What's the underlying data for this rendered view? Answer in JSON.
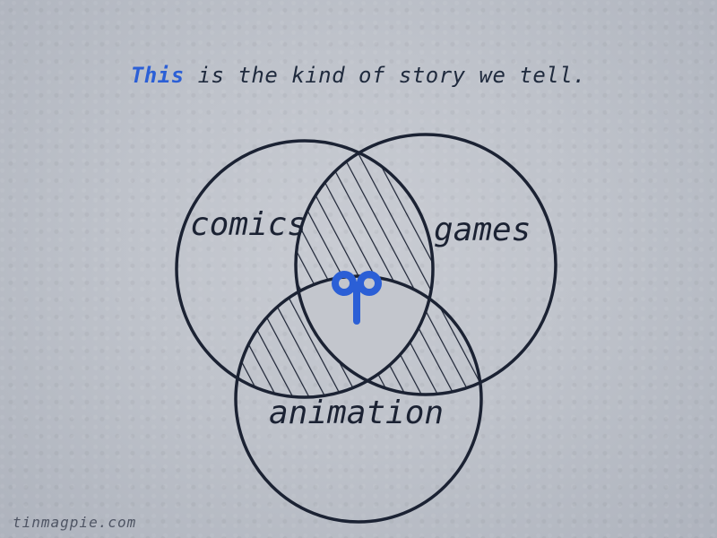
{
  "headline": {
    "accent_word": "This",
    "rest": " is the kind of story we tell."
  },
  "diagram": {
    "circles": [
      {
        "label": "comics"
      },
      {
        "label": "games"
      },
      {
        "label": "animation"
      }
    ],
    "center_symbol": "logo-mark",
    "stroke_color": "#1b2233",
    "accent_color": "#2b5fd6"
  },
  "footer": {
    "text": "tinmagpie.com"
  }
}
